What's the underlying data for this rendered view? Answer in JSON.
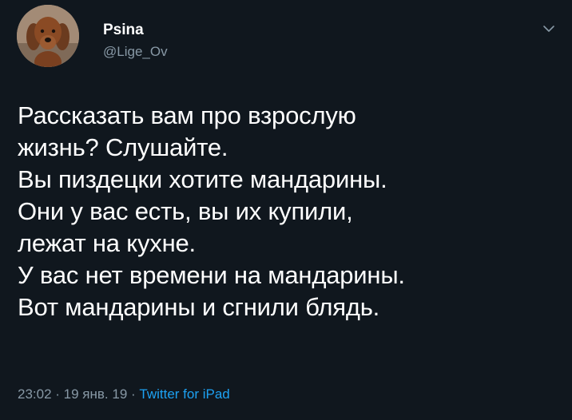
{
  "tweet": {
    "author": {
      "display_name": "Psina",
      "handle": "@Lige_Ov",
      "avatar_icon": "dog-avatar"
    },
    "menu_icon": "chevron-down-icon",
    "text_lines": [
      "Рассказать вам про взрослую",
      "жизнь? Слушайте.",
      "Вы пиздецки хотите мандарины.",
      "Они у вас есть, вы их купили,",
      "лежат на кухне.",
      "У вас нет времени на мандарины.",
      "Вот мандарины и сгнили блядь."
    ],
    "meta": {
      "time": "23:02",
      "separator": " · ",
      "date": "19 янв. 19",
      "source": "Twitter for iPad"
    },
    "colors": {
      "background": "#10171e",
      "text": "#ffffff",
      "secondary": "#8899a6",
      "link": "#1da1f2"
    }
  }
}
